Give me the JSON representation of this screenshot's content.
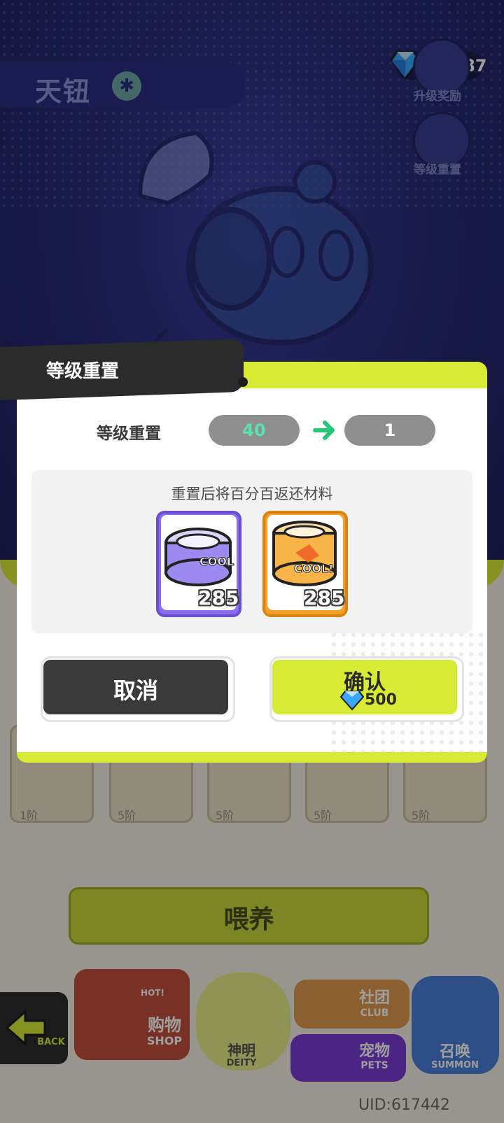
{
  "header": {
    "title": "天钮",
    "title_badge": "✱",
    "gems": "22687",
    "upgrade_reward_label": "升级奖励",
    "level_reset_label": "等级重置"
  },
  "dialog": {
    "title": "等级重置",
    "row_label": "等级重置",
    "level_from": "40",
    "level_to": "1",
    "materials_title": "重置后将百分百返还材料",
    "materials": [
      {
        "name": "purple-can",
        "count": "285",
        "color": "#8c6ff0"
      },
      {
        "name": "orange-can",
        "count": "285",
        "color": "#f4a12a"
      }
    ],
    "cancel_label": "取消",
    "confirm_label": "确认",
    "confirm_cost": "500"
  },
  "cards": [
    {
      "tier": "1阶"
    },
    {
      "tier": "5阶"
    },
    {
      "tier": "5阶"
    },
    {
      "tier": "5阶"
    },
    {
      "tier": "5阶"
    }
  ],
  "feed_label": "喂养",
  "nav": {
    "back": "BACK",
    "shop_cn": "购物",
    "shop_en": "SHOP",
    "shop_badge": "HOT!",
    "deity_cn": "神明",
    "deity_en": "DEITY",
    "club_cn": "社团",
    "club_en": "CLUB",
    "pets_cn": "宠物",
    "pets_en": "PETS",
    "summon_cn": "召唤",
    "summon_en": "SUMMON"
  },
  "uid": "UID:617442",
  "colors": {
    "accent_lime": "#d7ea34",
    "dialog_dark": "#2b2b2b",
    "level_from_color": "#56e3b0",
    "arrow_green": "#26c777"
  }
}
